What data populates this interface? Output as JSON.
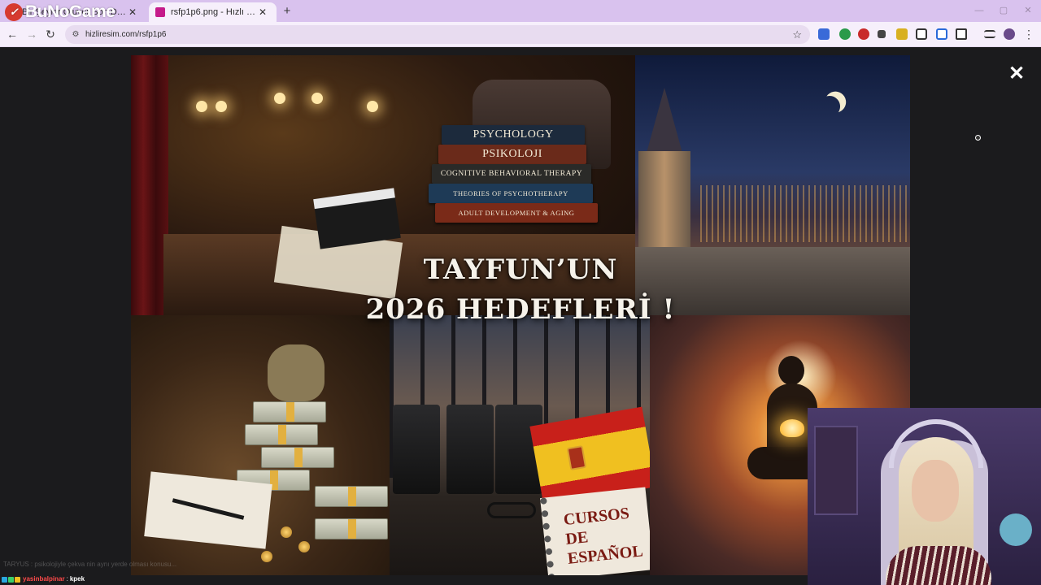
{
  "browser": {
    "tabs": [
      {
        "label": "Bir Şeyler Oluyor Son Dakika...",
        "active": false,
        "favicon_color": "#d63a2f"
      },
      {
        "label": "rsfp1p6.png - Hızlı Resim",
        "active": true,
        "favicon_color": "#c51a8a"
      }
    ],
    "tab_close_symbol": "✕",
    "new_tab_symbol": "+",
    "window_controls": {
      "minimize": "—",
      "maximize": "▢",
      "close": "✕"
    },
    "url": "hizliresim.com/rsfp1p6",
    "accent_color": "#d9c2ee"
  },
  "watermark": {
    "text": "BuNoGame",
    "logo": "✓"
  },
  "lightbox": {
    "close_symbol": "✕",
    "image": {
      "title_line1": "TAYFUN’UN",
      "title_line2": "2026 HEDEFLERİ !",
      "books": [
        "PSYCHOLOGY",
        "PSIKOLOJI",
        "COGNITIVE BEHAVIORAL THERAPY",
        "THEORIES OF PSYCHOTHERAPY",
        "ADULT DEVELOPMENT & AGING"
      ],
      "notebook_text_line1": "CURSOS DE",
      "notebook_text_line2": "ESPAÑOL"
    }
  },
  "chat": {
    "faded_line": "TARYUS : psikolojiyle çekva nin aynı yerde olması konusu...",
    "message": {
      "user": "yasinbalpinar",
      "separator": ":",
      "text": "kpek"
    }
  }
}
